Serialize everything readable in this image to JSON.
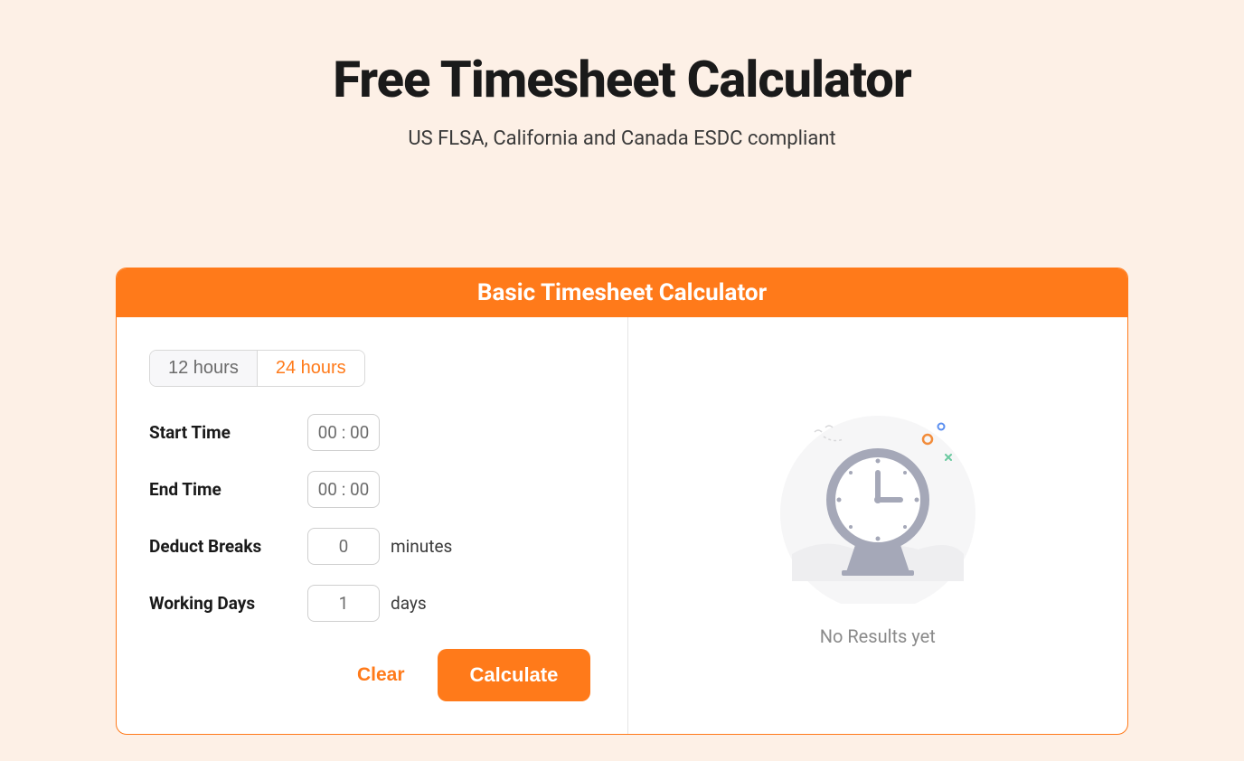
{
  "header": {
    "title": "Free Timesheet Calculator",
    "subtitle": "US FLSA, California and Canada ESDC compliant"
  },
  "card": {
    "title": "Basic Timesheet Calculator",
    "toggle": {
      "option12": "12 hours",
      "option24": "24 hours",
      "active": "12"
    },
    "form": {
      "startTime": {
        "label": "Start Time",
        "value": "00 : 00"
      },
      "endTime": {
        "label": "End Time",
        "value": "00 : 00"
      },
      "deductBreaks": {
        "label": "Deduct Breaks",
        "value": "0",
        "unit": "minutes"
      },
      "workingDays": {
        "label": "Working Days",
        "value": "1",
        "unit": "days"
      }
    },
    "actions": {
      "clear": "Clear",
      "calculate": "Calculate"
    },
    "results": {
      "emptyText": "No Results yet"
    }
  }
}
